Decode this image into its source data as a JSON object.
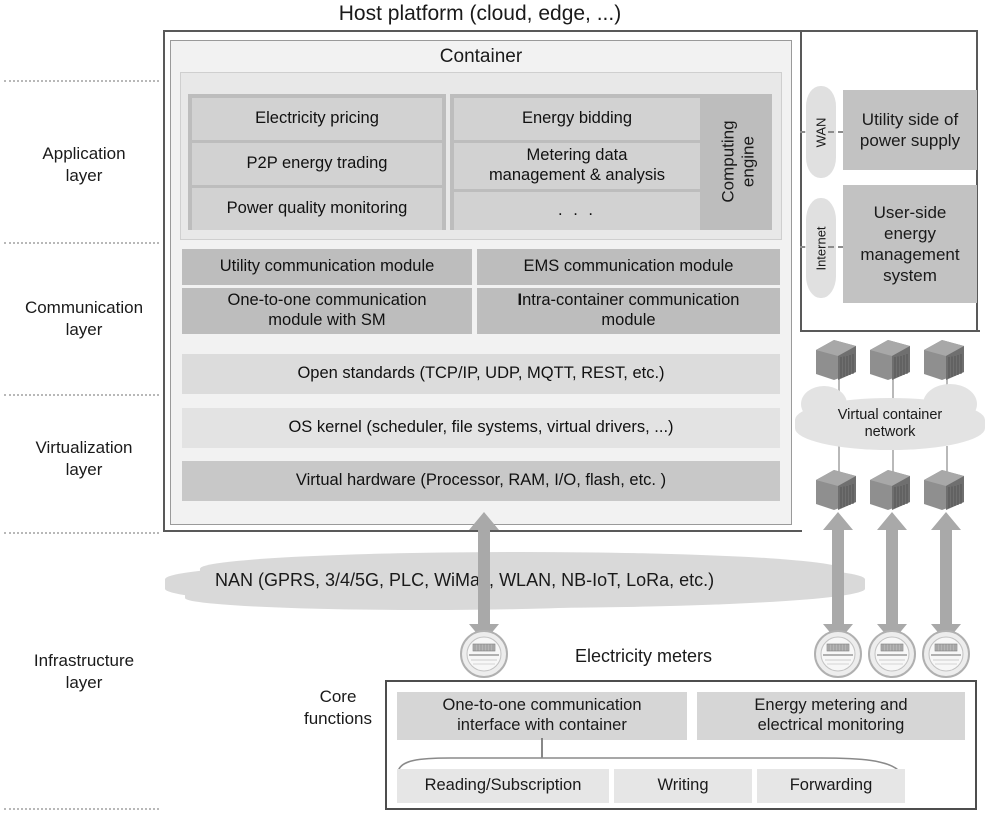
{
  "title": "Host platform (cloud, edge, ...)",
  "container": {
    "label": "Container"
  },
  "layers": [
    {
      "name": "application",
      "label": "Application\nlayer"
    },
    {
      "name": "communication",
      "label": "Communication\nlayer"
    },
    {
      "name": "virtualization",
      "label": "Virtualization\nlayer"
    },
    {
      "name": "infrastructure",
      "label": "Infrastructure\nlayer"
    }
  ],
  "application": {
    "left_items": [
      "Electricity pricing",
      "P2P energy trading",
      "Power quality monitoring"
    ],
    "right_items": [
      "Energy bidding",
      "Metering data\nmanagement & analysis",
      ". . ."
    ],
    "computing_engine": "Computing\nengine"
  },
  "communication": {
    "modules": [
      "Utility communication module",
      "EMS communication module",
      "One-to-one communication\nmodule with SM",
      "Intra-container communication\nmodule"
    ],
    "open_standards": "Open standards (TCP/IP, UDP, MQTT, REST, etc.)"
  },
  "virtualization": {
    "os_kernel": "OS kernel (scheduler, file systems, virtual drivers, ...)",
    "virtual_hardware": "Virtual hardware (Processor, RAM, I/O, flash, etc. )"
  },
  "external": {
    "links": [
      {
        "name": "wan",
        "label": "WAN"
      },
      {
        "name": "internet",
        "label": "Internet"
      }
    ],
    "boxes": [
      {
        "name": "utility-side",
        "label": "Utility side of\npower supply"
      },
      {
        "name": "user-side",
        "label": "User-side\nenergy\nmanagement\nsystem"
      }
    ]
  },
  "virtual_container_network": {
    "label": "Virtual container\nnetwork",
    "container_count_top": 3,
    "container_count_bottom": 3
  },
  "infrastructure": {
    "nan_label": "NAN (GPRS, 3/4/5G, PLC,   WiMax, WLAN,  NB-IoT, LoRa, etc.)",
    "electricity_meters_label": "Electricity meters",
    "meter_count_right": 3,
    "meter_count_left": 1
  },
  "core_functions": {
    "label": "Core\nfunctions",
    "primary": [
      "One-to-one communication\ninterface with container",
      "Energy metering and\nelectrical monitoring"
    ],
    "secondary": [
      "Reading/Subscription",
      "Writing",
      "Forwarding"
    ]
  },
  "colors": {
    "box_dark": "#bdbdbd",
    "box_mid": "#c8c8c8",
    "box_light": "#d6d6d6",
    "panel": "#e8e8e8",
    "border": "#595959",
    "arrow": "#a9a9a9",
    "cloud": "#d9d9d9"
  }
}
